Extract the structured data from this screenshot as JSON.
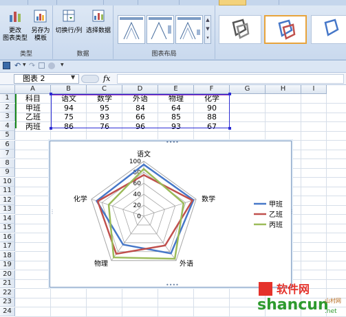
{
  "ribbon": {
    "groups": [
      {
        "label": "类型",
        "buttons": [
          {
            "line1": "更改",
            "line2": "图表类型"
          },
          {
            "line1": "另存为",
            "line2": "模板"
          }
        ]
      },
      {
        "label": "数据",
        "buttons": [
          {
            "label": "切换行/列"
          },
          {
            "label": "选择数据"
          }
        ]
      },
      {
        "label": "图表布局"
      }
    ]
  },
  "formula_bar": {
    "namebox": "图表 2",
    "fx": "fx",
    "formula": ""
  },
  "sheet": {
    "columns": [
      "A",
      "B",
      "C",
      "D",
      "E",
      "F",
      "G",
      "H",
      "I"
    ],
    "rows": [
      "1",
      "2",
      "3",
      "4",
      "5",
      "6",
      "7",
      "8",
      "9",
      "10",
      "11",
      "12",
      "13",
      "14",
      "15",
      "16",
      "17",
      "18",
      "19",
      "20",
      "21",
      "22",
      "23",
      "24"
    ],
    "data": [
      [
        "科目",
        "语文",
        "数学",
        "外语",
        "物理",
        "化学"
      ],
      [
        "甲班",
        "94",
        "95",
        "84",
        "64",
        "90"
      ],
      [
        "乙班",
        "75",
        "93",
        "66",
        "85",
        "88"
      ],
      [
        "丙班",
        "86",
        "76",
        "96",
        "93",
        "67"
      ]
    ]
  },
  "colors": {
    "series1": "#4677c8",
    "series2": "#c0504d",
    "series3": "#9bbb59",
    "selection": "#2b2bd4",
    "ribbon_accent": "#f3d27c"
  },
  "chart_data": {
    "type": "radar",
    "categories": [
      "语文",
      "数学",
      "外语",
      "物理",
      "化学"
    ],
    "series": [
      {
        "name": "甲班",
        "values": [
          94,
          95,
          84,
          64,
          90
        ]
      },
      {
        "name": "乙班",
        "values": [
          75,
          93,
          66,
          85,
          88
        ]
      },
      {
        "name": "丙班",
        "values": [
          86,
          76,
          96,
          93,
          67
        ]
      }
    ],
    "ticks": [
      "0",
      "20",
      "40",
      "60",
      "80",
      "100"
    ],
    "rmax": 100,
    "legend_position": "right"
  },
  "watermark": {
    "line1": "软件网",
    "line2": "shancun",
    "line3": ".net",
    "line4": "山村网"
  }
}
